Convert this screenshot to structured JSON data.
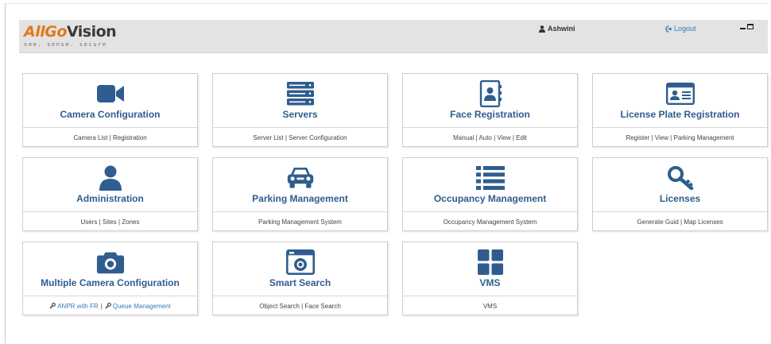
{
  "app": {
    "logo_main_a": "AllGo",
    "logo_main_b": "Vision",
    "logo_tagline": "see. sense. secure"
  },
  "header": {
    "user_name": "Ashwini",
    "logout_label": "Logout"
  },
  "colors": {
    "icon": "#2f5d8f",
    "title": "#2f5d8f",
    "link": "#3a7ab8",
    "logo_orange": "#e07a1f"
  },
  "tiles": [
    {
      "title": "Camera Configuration",
      "sub": "Camera List | Registration",
      "icon": "video-camera-icon"
    },
    {
      "title": "Servers",
      "sub": "Server List | Server Configuration",
      "icon": "server-stack-icon"
    },
    {
      "title": "Face Registration",
      "sub": "Manual | Auto | View | Edit",
      "icon": "contact-book-icon"
    },
    {
      "title": "License Plate Registration",
      "sub": "Register | View | Parking Management",
      "icon": "id-card-icon"
    },
    {
      "title": "Administration",
      "sub": "Users | Sites | Zones",
      "icon": "user-icon"
    },
    {
      "title": "Parking Management",
      "sub": "Parking Management System",
      "icon": "car-icon"
    },
    {
      "title": "Occupancy Management",
      "sub": "Occupancy Management System",
      "icon": "list-icon"
    },
    {
      "title": "Licenses",
      "sub": "Generate Guid | Map Licenses",
      "icon": "key-icon"
    },
    {
      "title": "Multiple Camera Configuration",
      "sub_link_1": "ANPR with FR",
      "sub_sep": "|",
      "sub_link_2": "Queue Management",
      "icon": "photo-camera-icon"
    },
    {
      "title": "Smart Search",
      "sub": "Object Search | Face Search",
      "icon": "camera-frame-icon"
    },
    {
      "title": "VMS",
      "sub": "VMS",
      "icon": "grid-icon"
    }
  ]
}
